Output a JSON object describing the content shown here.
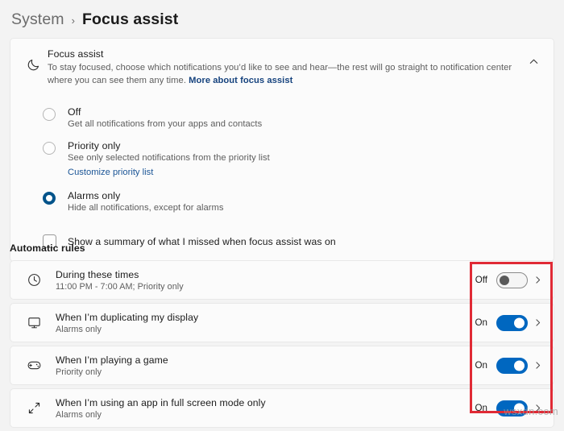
{
  "breadcrumb": {
    "parent": "System",
    "separator": "›",
    "current": "Focus assist"
  },
  "focus_card": {
    "icon": "moon-icon",
    "title": "Focus assist",
    "description": "To stay focused, choose which notifications you’d like to see and hear—the rest will go straight to notification center where you can see them any time.",
    "link_label": "More about focus assist",
    "collapse_icon": "chevron-up-icon",
    "options": [
      {
        "label": "Off",
        "sublabel": "Get all notifications from your apps and contacts",
        "selected": false,
        "link": null
      },
      {
        "label": "Priority only",
        "sublabel": "See only selected notifications from the priority list",
        "selected": false,
        "link": "Customize priority list"
      },
      {
        "label": "Alarms only",
        "sublabel": "Hide all notifications, except for alarms",
        "selected": true,
        "link": null
      }
    ],
    "summary_checkbox": {
      "label": "Show a summary of what I missed when focus assist was on",
      "checked": false
    }
  },
  "automatic_rules": {
    "section_title": "Automatic rules",
    "rules": [
      {
        "icon": "clock-icon",
        "title": "During these times",
        "sublabel": "11:00 PM - 7:00 AM; Priority only",
        "state_label": "Off",
        "toggle_on": false
      },
      {
        "icon": "monitor-icon",
        "title": "When I’m duplicating my display",
        "sublabel": "Alarms only",
        "state_label": "On",
        "toggle_on": true
      },
      {
        "icon": "gamepad-icon",
        "title": "When I’m playing a game",
        "sublabel": "Priority only",
        "state_label": "On",
        "toggle_on": true
      },
      {
        "icon": "fullscreen-icon",
        "title": "When I’m using an app in full screen mode only",
        "sublabel": "Alarms only",
        "state_label": "On",
        "toggle_on": true
      }
    ]
  },
  "watermark": {
    "text": "wsxdn.com"
  },
  "colors": {
    "accent": "#0067c0",
    "accent_dark": "#00538a",
    "link": "#16437e",
    "annotation": "#e02a35",
    "page_bg": "#f3f3f3",
    "card_bg": "#fbfbfb"
  }
}
